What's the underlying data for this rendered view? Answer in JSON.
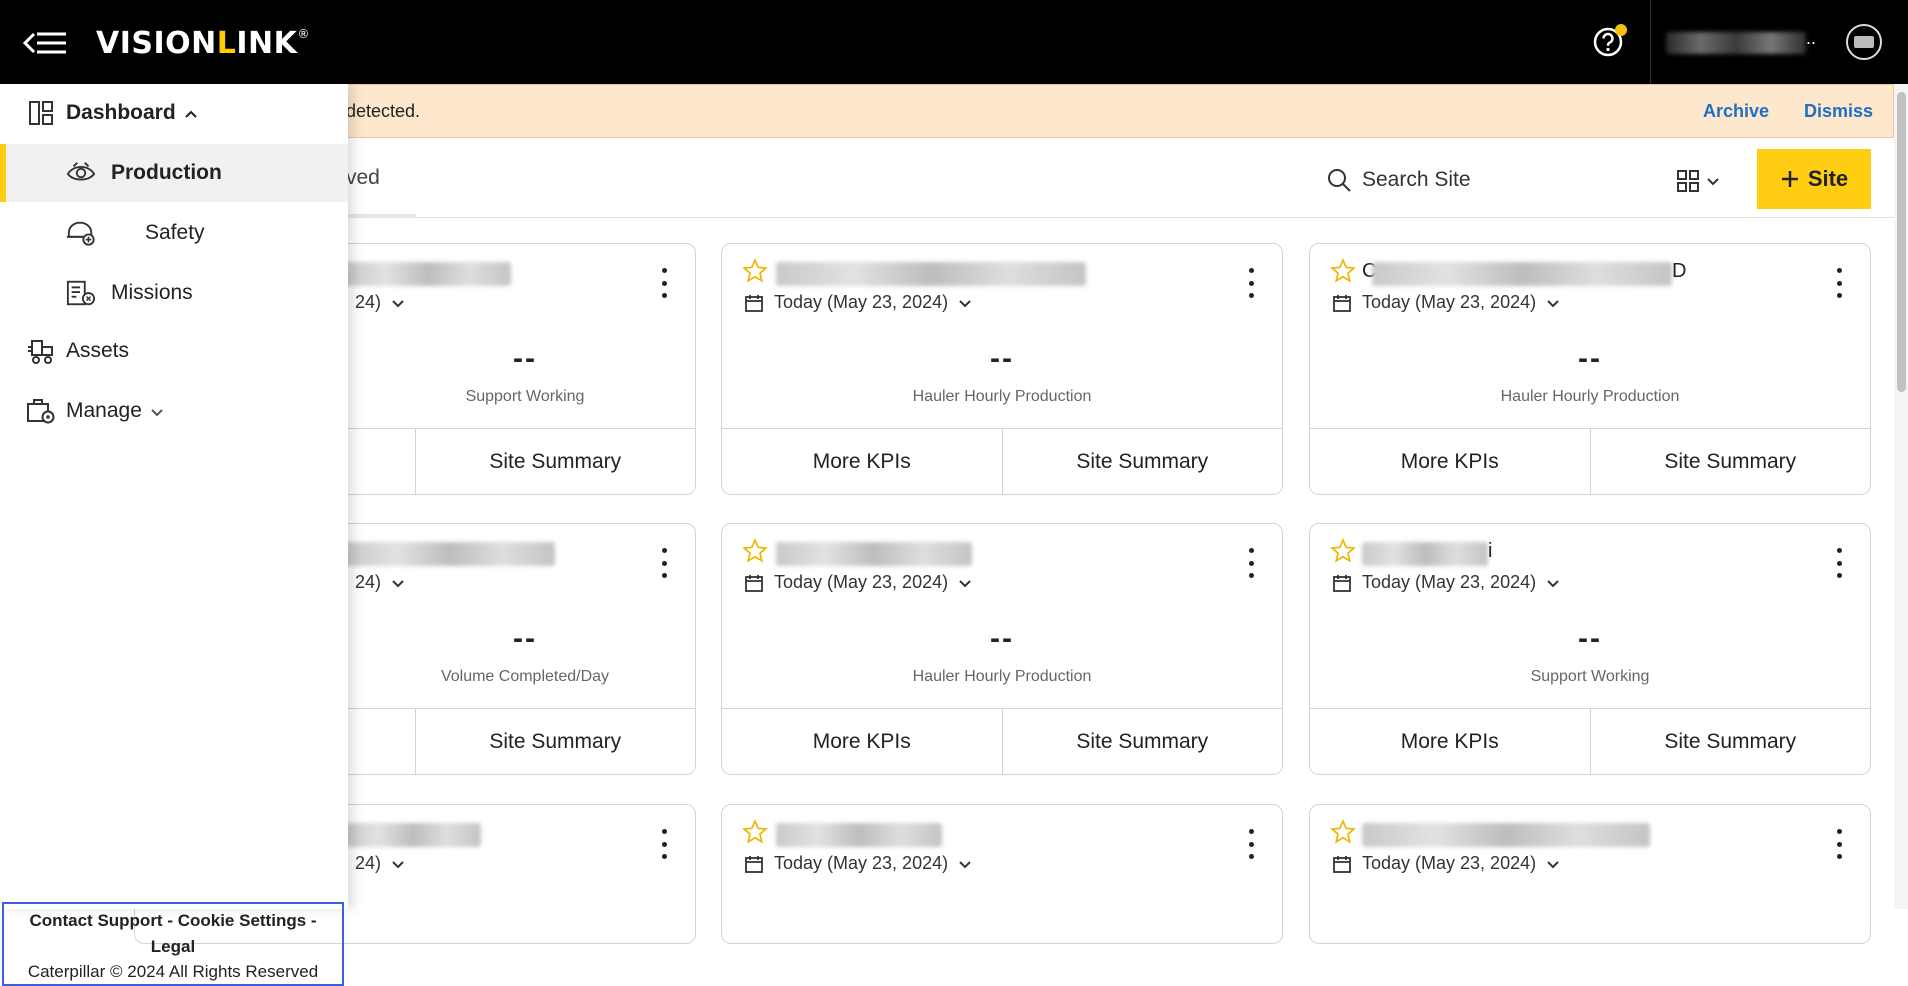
{
  "app": {
    "brand_left": "VISION",
    "brand_accent": "L",
    "brand_right": "INK",
    "brand_mark": "®",
    "accent_color": "#FFCD11"
  },
  "header": {
    "user_ellipsis": ".."
  },
  "banner": {
    "text": ") detected.",
    "archive_label": "Archive",
    "dismiss_label": "Dismiss"
  },
  "sidebar": {
    "items": [
      {
        "label": "Dashboard",
        "icon": "dashboard-icon"
      },
      {
        "label": "Production",
        "icon": "production-eye-icon",
        "active": true
      },
      {
        "label": "Safety",
        "icon": "safety-helmet-icon"
      },
      {
        "label": "Missions",
        "icon": "missions-icon"
      },
      {
        "label": "Assets",
        "icon": "assets-icon"
      },
      {
        "label": "Manage",
        "icon": "manage-icon"
      }
    ],
    "footer": {
      "contact": "Contact Support",
      "sep": " - ",
      "cookie": "Cookie Settings",
      "legal": "Legal",
      "copyright": "Caterpillar © 2024 All Rights Reserved"
    }
  },
  "toolbar": {
    "tab_fragment": "ved",
    "search_placeholder": "Search Site",
    "add_site_label": "Site"
  },
  "cards": [
    {
      "date": "24)",
      "value": "--",
      "kpi": "Support Working",
      "btn_left": "",
      "btn_right": "Site Summary"
    },
    {
      "date": "Today (May 23, 2024)",
      "value": "--",
      "kpi": "Hauler Hourly Production",
      "btn_left": "More KPIs",
      "btn_right": "Site Summary"
    },
    {
      "name_prefix": "C",
      "name_suffix": "D",
      "date": "Today (May 23, 2024)",
      "value": "--",
      "kpi": "Hauler Hourly Production",
      "btn_left": "More KPIs",
      "btn_right": "Site Summary"
    },
    {
      "date": "24)",
      "value": "--",
      "kpi": "Volume Completed/Day",
      "btn_left": "",
      "btn_right": "Site Summary"
    },
    {
      "date": "Today (May 23, 2024)",
      "value": "--",
      "kpi": "Hauler Hourly Production",
      "btn_left": "More KPIs",
      "btn_right": "Site Summary"
    },
    {
      "name_suffix": "i",
      "date": "Today (May 23, 2024)",
      "value": "--",
      "kpi": "Support Working",
      "btn_left": "More KPIs",
      "btn_right": "Site Summary"
    },
    {
      "date": "24)"
    },
    {
      "date": "Today (May 23, 2024)"
    },
    {
      "date": "Today (May 23, 2024)"
    }
  ]
}
